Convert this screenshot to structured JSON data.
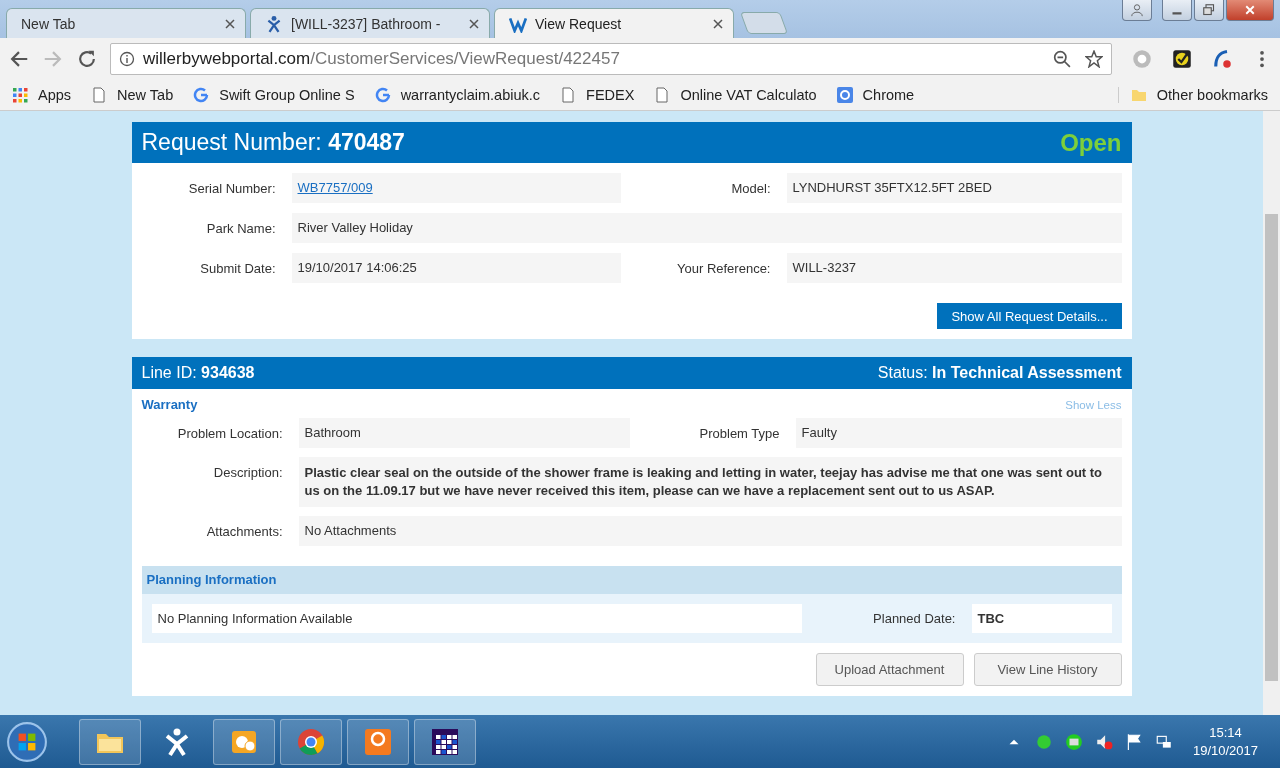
{
  "browser": {
    "tabs": [
      {
        "title": "New Tab",
        "selected": false
      },
      {
        "title": "[WILL-3237] Bathroom -",
        "selected": false
      },
      {
        "title": "View Request",
        "selected": true
      }
    ],
    "address": {
      "domain": "willerbywebportal.com",
      "path": "/CustomerServices/ViewRequest/422457"
    },
    "bookmarks": [
      {
        "label": "Apps",
        "kind": "apps"
      },
      {
        "label": "New Tab",
        "kind": "page"
      },
      {
        "label": "Swift Group Online S",
        "kind": "google"
      },
      {
        "label": "warrantyclaim.abiuk.c",
        "kind": "google"
      },
      {
        "label": "FEDEX",
        "kind": "page"
      },
      {
        "label": "Online VAT Calculato",
        "kind": "page"
      },
      {
        "label": "Chrome",
        "kind": "gsquare"
      }
    ],
    "other_bookmarks": "Other bookmarks"
  },
  "request": {
    "label": "Request Number:",
    "number": "470487",
    "status": "Open",
    "rows": [
      [
        {
          "label": "Serial Number:",
          "value": "WB7757/009",
          "kind": "link"
        },
        {
          "label": "Model:",
          "value": "LYNDHURST 35FTX12.5FT 2BED",
          "kind": "text"
        }
      ],
      [
        {
          "label": "Park Name:",
          "value": "River Valley Holiday",
          "kind": "text"
        }
      ],
      [
        {
          "label": "Submit Date:",
          "value": "19/10/2017 14:06:25",
          "kind": "text"
        },
        {
          "label": "Your Reference:",
          "value": "WILL-3237",
          "kind": "text"
        }
      ]
    ],
    "button": "Show All Request Details..."
  },
  "line": {
    "label": "Line ID:",
    "id": "934638",
    "status_label": "Status:",
    "status": "In Technical Assessment",
    "section": "Warranty",
    "toggle": "Show Less",
    "rows": [
      [
        {
          "label": "Problem Location:",
          "value": "Bathroom",
          "kind": "text"
        },
        {
          "label": "Problem Type",
          "value": "Faulty",
          "kind": "text"
        }
      ],
      [
        {
          "label": "Description:",
          "value": "Plastic clear seal on the outside of the shower frame is leaking and letting in water, teejay has advise me that one was sent out to us on the 11.09.17 but we have never received this item, please can we have a replacement sent out to us ASAP.",
          "kind": "bold"
        }
      ],
      [
        {
          "label": "Attachments:",
          "value": "No Attachments",
          "kind": "text"
        }
      ]
    ],
    "planning": {
      "title": "Planning Information",
      "message": "No Planning Information Available",
      "date_label": "Planned Date:",
      "date": "TBC"
    },
    "buttons": [
      "Upload Attachment",
      "View Line History"
    ]
  },
  "taskbar": {
    "time": "15:14",
    "date": "19/10/2017"
  }
}
